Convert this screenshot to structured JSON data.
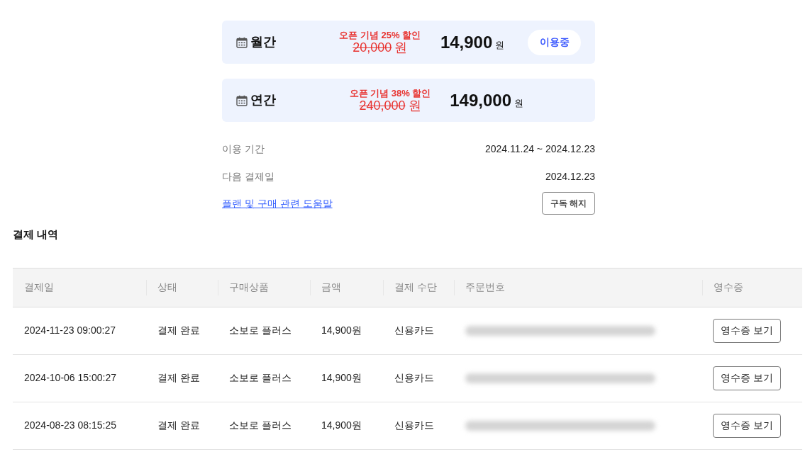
{
  "plans": [
    {
      "name": "월간",
      "promo": "오픈 기념 25% 할인",
      "original_price": "20,000",
      "original_unit": "원",
      "price": "14,900",
      "unit": "원",
      "badge": "이용중"
    },
    {
      "name": "연간",
      "promo": "오픈 기념 38% 할인",
      "original_price": "240,000",
      "original_unit": "원",
      "price": "149,000",
      "unit": "원"
    }
  ],
  "subscription": {
    "rows": [
      {
        "label": "이용 기간",
        "value": "2024.11.24 ~ 2024.12.23"
      },
      {
        "label": "다음 결제일",
        "value": "2024.12.23"
      }
    ],
    "help_link": "플랜 및 구매 관련 도움말",
    "cancel_button": "구독 해지"
  },
  "payment_history": {
    "title": "결제 내역",
    "columns": [
      "결제일",
      "상태",
      "구매상품",
      "금액",
      "결제 수단",
      "주문번호",
      "영수증"
    ],
    "rows": [
      {
        "date": "2024-11-23 09:00:27",
        "status": "결제 완료",
        "product": "소보로 플러스",
        "amount": "14,900원",
        "method": "신용카드",
        "receipt_button": "영수증 보기"
      },
      {
        "date": "2024-10-06 15:00:27",
        "status": "결제 완료",
        "product": "소보로 플러스",
        "amount": "14,900원",
        "method": "신용카드",
        "receipt_button": "영수증 보기"
      },
      {
        "date": "2024-08-23 08:15:25",
        "status": "결제 완료",
        "product": "소보로 플러스",
        "amount": "14,900원",
        "method": "신용카드",
        "receipt_button": "영수증 보기"
      }
    ]
  }
}
